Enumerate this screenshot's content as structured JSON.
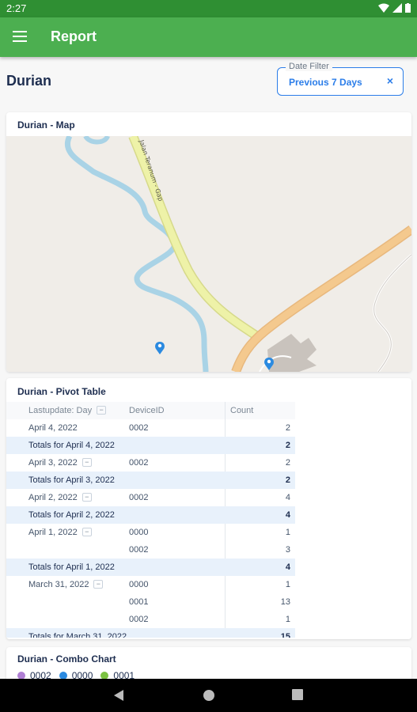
{
  "status_bar": {
    "time": "2:27"
  },
  "app_bar": {
    "title": "Report"
  },
  "page": {
    "title": "Durian"
  },
  "date_filter": {
    "label": "Date Filter",
    "value": "Previous 7 Days",
    "clear": "×"
  },
  "map_card": {
    "title": "Durian - Map",
    "road_label": "Jalan Teranum - Gap"
  },
  "pivot_card": {
    "title": "Durian - Pivot Table",
    "headers": {
      "col1": "Lastupdate: Day",
      "col2": "DeviceID",
      "col3": "Count"
    },
    "collapse_symbol": "−",
    "rows": [
      {
        "kind": "data",
        "date": "April 4, 2022",
        "device": "0002",
        "count": "2"
      },
      {
        "kind": "total",
        "date": "Totals for April 4, 2022",
        "device": "",
        "count": "2"
      },
      {
        "kind": "data",
        "date": "April 3, 2022",
        "device": "0002",
        "count": "2"
      },
      {
        "kind": "total",
        "date": "Totals for April 3, 2022",
        "device": "",
        "count": "2"
      },
      {
        "kind": "data",
        "date": "April 2, 2022",
        "device": "0002",
        "count": "4"
      },
      {
        "kind": "total",
        "date": "Totals for April 2, 2022",
        "device": "",
        "count": "4"
      },
      {
        "kind": "data",
        "date": "April 1, 2022",
        "device": "0000",
        "count": "1"
      },
      {
        "kind": "sub",
        "date": "",
        "device": "0002",
        "count": "3"
      },
      {
        "kind": "total",
        "date": "Totals for April 1, 2022",
        "device": "",
        "count": "4"
      },
      {
        "kind": "data",
        "date": "March 31, 2022",
        "device": "0000",
        "count": "1"
      },
      {
        "kind": "sub",
        "date": "",
        "device": "0001",
        "count": "13"
      },
      {
        "kind": "sub",
        "date": "",
        "device": "0002",
        "count": "1"
      },
      {
        "kind": "total",
        "date": "Totals for March 31, 2022",
        "device": "",
        "count": "15"
      }
    ]
  },
  "combo_card": {
    "title": "Durian - Combo Chart",
    "legend": [
      {
        "label": "0002",
        "color": "#b07fd4"
      },
      {
        "label": "0000",
        "color": "#2b8ae0"
      },
      {
        "label": "0001",
        "color": "#7cc242"
      }
    ]
  },
  "colors": {
    "app_bar": "#4caf50",
    "status_bar": "#2f8f33",
    "accent": "#2b7de9",
    "total_row": "#e8f1fb"
  }
}
